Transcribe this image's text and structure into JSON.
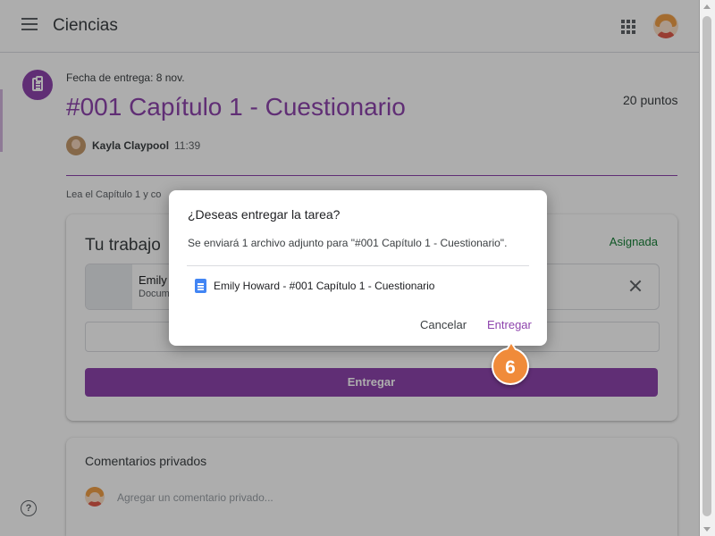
{
  "header": {
    "title": "Ciencias",
    "menu_icon": "menu-icon",
    "apps_icon": "apps-grid-icon"
  },
  "assignment": {
    "icon": "assignment-icon",
    "due": "Fecha de entrega: 8 nov.",
    "title": "#001 Capítulo 1 - Cuestionario",
    "points": "20 puntos",
    "teacher": "Kayla Claypool",
    "time": "11:39",
    "instructions": "Lea el Capítulo 1 y co"
  },
  "work": {
    "title": "Tu trabajo",
    "status": "Asignada",
    "attachment_name": "Emily",
    "attachment_type": "Docum",
    "submit_label": "Entregar"
  },
  "comments": {
    "title": "Comentarios privados",
    "placeholder": "Agregar un comentario privado..."
  },
  "help_label": "?",
  "dialog": {
    "title": "¿Deseas entregar la tarea?",
    "body": "Se enviará 1 archivo adjunto para \"#001 Capítulo 1 - Cuestionario\".",
    "file_name": "Emily Howard - #001 Capítulo 1 - Cuestionario",
    "cancel_label": "Cancelar",
    "submit_label": "Entregar"
  },
  "step": "6",
  "colors": {
    "accent": "#8e44ad",
    "status_green": "#188038",
    "callout": "#f08b3a"
  }
}
